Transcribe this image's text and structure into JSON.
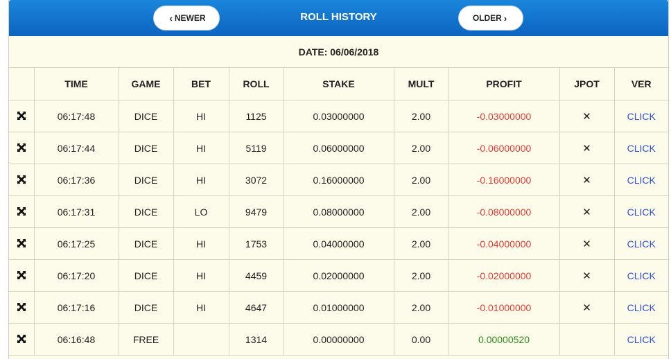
{
  "header": {
    "title": "ROLL HISTORY",
    "newer_label": "NEWER",
    "older_label": "OLDER"
  },
  "date_label": "DATE: 06/06/2018",
  "columns": [
    "TIME",
    "GAME",
    "BET",
    "ROLL",
    "STAKE",
    "MULT",
    "PROFIT",
    "JPOT",
    "VER"
  ],
  "rows": [
    {
      "time": "06:17:48",
      "game": "DICE",
      "bet": "HI",
      "roll": "1125",
      "stake": "0.03000000",
      "mult": "2.00",
      "profit": "-0.03000000",
      "profit_sign": "neg",
      "jpot": "✕",
      "ver": "CLICK"
    },
    {
      "time": "06:17:44",
      "game": "DICE",
      "bet": "HI",
      "roll": "5119",
      "stake": "0.06000000",
      "mult": "2.00",
      "profit": "-0.06000000",
      "profit_sign": "neg",
      "jpot": "✕",
      "ver": "CLICK"
    },
    {
      "time": "06:17:36",
      "game": "DICE",
      "bet": "HI",
      "roll": "3072",
      "stake": "0.16000000",
      "mult": "2.00",
      "profit": "-0.16000000",
      "profit_sign": "neg",
      "jpot": "✕",
      "ver": "CLICK"
    },
    {
      "time": "06:17:31",
      "game": "DICE",
      "bet": "LO",
      "roll": "9479",
      "stake": "0.08000000",
      "mult": "2.00",
      "profit": "-0.08000000",
      "profit_sign": "neg",
      "jpot": "✕",
      "ver": "CLICK"
    },
    {
      "time": "06:17:25",
      "game": "DICE",
      "bet": "HI",
      "roll": "1753",
      "stake": "0.04000000",
      "mult": "2.00",
      "profit": "-0.04000000",
      "profit_sign": "neg",
      "jpot": "✕",
      "ver": "CLICK"
    },
    {
      "time": "06:17:20",
      "game": "DICE",
      "bet": "HI",
      "roll": "4459",
      "stake": "0.02000000",
      "mult": "2.00",
      "profit": "-0.02000000",
      "profit_sign": "neg",
      "jpot": "✕",
      "ver": "CLICK"
    },
    {
      "time": "06:17:16",
      "game": "DICE",
      "bet": "HI",
      "roll": "4647",
      "stake": "0.01000000",
      "mult": "2.00",
      "profit": "-0.01000000",
      "profit_sign": "neg",
      "jpot": "✕",
      "ver": "CLICK"
    },
    {
      "time": "06:16:48",
      "game": "FREE",
      "bet": "",
      "roll": "1314",
      "stake": "0.00000000",
      "mult": "0.00",
      "profit": "0.00000520",
      "profit_sign": "pos",
      "jpot": "",
      "ver": "CLICK"
    }
  ],
  "colors": {
    "header_blue": "#1a86dc",
    "panel_bg": "#fdfbe9",
    "negative": "#e53935",
    "positive": "#2e8b1f",
    "link": "#2f52d9"
  },
  "icons": {
    "row_expand": "expand-arrows-icon",
    "newer_chevron": "chevron-left-icon",
    "older_chevron": "chevron-right-icon"
  }
}
